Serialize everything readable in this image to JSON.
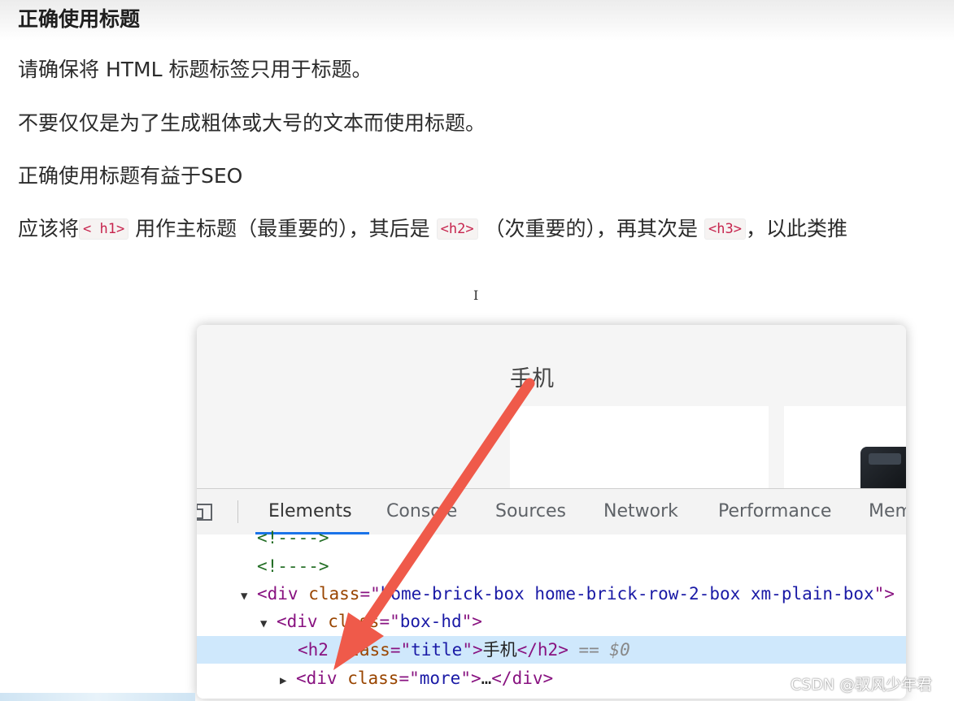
{
  "article": {
    "heading": "正确使用标题",
    "p1": "请确保将 HTML 标题标签只用于标题。",
    "p2": "不要仅仅是为了生成粗体或大号的文本而使用标题。",
    "p3": "正确使用标题有益于SEO",
    "p4": {
      "part1": "应该将",
      "code1": "< h1>",
      "part2": "用作主标题（最重要的），其后是",
      "code2": "<h2>",
      "part3": "（次重要的），再其次是",
      "code3": "<h3>",
      "part4": "，以此类推"
    }
  },
  "screenshot": {
    "preview_title": "手机",
    "tabs": [
      "Elements",
      "Console",
      "Sources",
      "Network",
      "Performance",
      "Mem"
    ],
    "active_tab": "Elements",
    "dom": {
      "comment1": "<!---->",
      "comment2": "<!---->",
      "div1_class": "home-brick-box home-brick-row-2-box xm-plain-box",
      "div2_class": "box-hd",
      "h2_class": "title",
      "h2_text": "手机",
      "h2_selected_marker": "== $0",
      "div3_class": "more",
      "div3_ellipsis": "…"
    },
    "arrow_color": "#ef5a4a"
  },
  "watermark": "CSDN @驭风少年君"
}
